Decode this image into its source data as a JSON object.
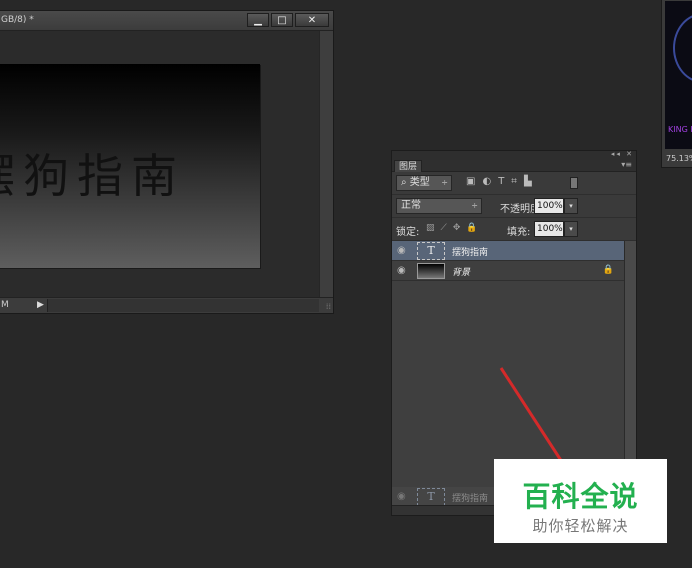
{
  "document": {
    "title": "GB/8) *",
    "canvas_text": "摆狗指南",
    "status_text": "M",
    "status_arrow": "▶",
    "grip": "⁞⁞",
    "buttons": {
      "minimize": "▁",
      "maximize": "□",
      "close": "✕"
    }
  },
  "navigator": {
    "label": "KING I",
    "zoom": "75.13%"
  },
  "layers_panel": {
    "collapse": "◂◂ ✕",
    "tab": "图层",
    "menu": "▾≡",
    "filter": {
      "search_icon": "⌕",
      "kind_label": "类型",
      "arrow": "÷",
      "icons": [
        "▣",
        "◐",
        "T",
        "⌗",
        "▙"
      ]
    },
    "blend_mode": "正常",
    "blend_arrow": "÷",
    "opacity_label": "不透明度:",
    "opacity_value": "100%",
    "lock_label": "锁定:",
    "lock_icons": [
      "▨",
      "⟋",
      "✥",
      "🔒"
    ],
    "fill_label": "填充:",
    "fill_value": "100%",
    "dropdown_btn": "▾",
    "layers": [
      {
        "name": "摆狗指南",
        "thumb": "T",
        "visible_icon": "◉",
        "selected": true
      },
      {
        "name": "背景",
        "thumb": "",
        "visible_icon": "◉",
        "lock_icon": "🔒",
        "selected": false
      }
    ],
    "ghost_layer": {
      "name": "摆狗指南",
      "thumb": "T",
      "visible_icon": "◉"
    }
  },
  "watermark": {
    "title": "百科全说",
    "subtitle": "助你轻松解决"
  },
  "colors": {
    "background": "#282828",
    "selection": "#586578",
    "arrow": "#d42a2a",
    "watermark_green": "#23b04f"
  }
}
